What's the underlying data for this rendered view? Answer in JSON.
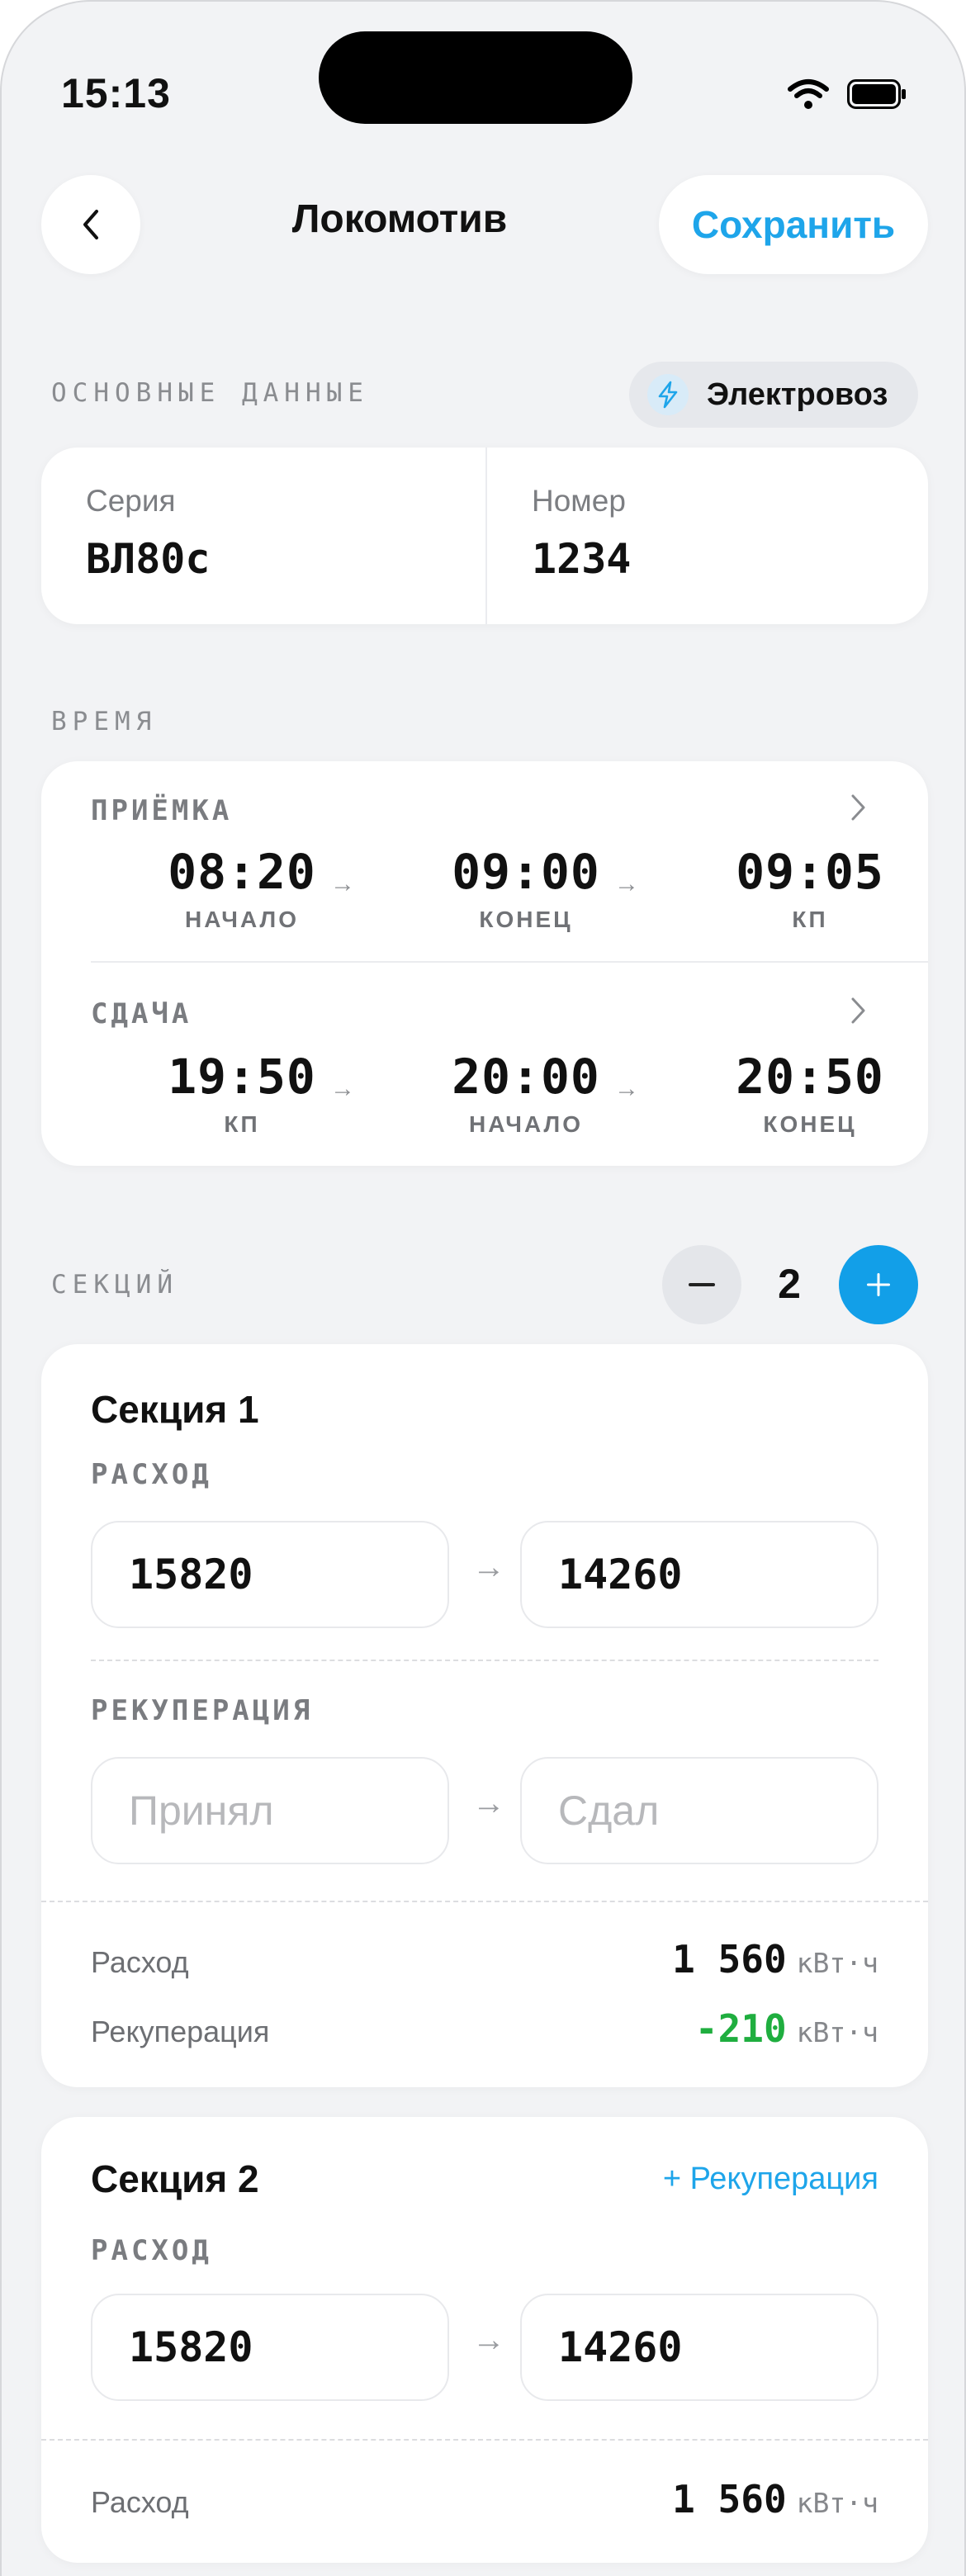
{
  "status_bar": {
    "time": "15:13"
  },
  "nav": {
    "title": "Локомотив",
    "save_label": "Сохранить"
  },
  "basic": {
    "section_label": "ОСНОВНЫЕ ДАННЫЕ",
    "type_label": "Электровоз",
    "series_label": "Серия",
    "series_value": "ВЛ80с",
    "number_label": "Номер",
    "number_value": "1234"
  },
  "time": {
    "section_label": "ВРЕМЯ",
    "acceptance": {
      "label": "ПРИЁМКА",
      "entries": [
        {
          "time": "08:20",
          "label": "НАЧАЛО"
        },
        {
          "time": "09:00",
          "label": "КОНЕЦ"
        },
        {
          "time": "09:05",
          "label": "КП"
        }
      ]
    },
    "handover": {
      "label": "СДАЧА",
      "entries": [
        {
          "time": "19:50",
          "label": "КП"
        },
        {
          "time": "20:00",
          "label": "НАЧАЛО"
        },
        {
          "time": "20:50",
          "label": "КОНЕЦ"
        }
      ]
    },
    "arrow": "→"
  },
  "sections": {
    "label": "СЕКЦИЙ",
    "count": "2",
    "items": [
      {
        "title": "Секция 1",
        "consumption_label": "РАСХОД",
        "consumption_from": "15820",
        "consumption_to": "14260",
        "recuperation_label": "РЕКУПЕРАЦИЯ",
        "recuperation_from_placeholder": "Принял",
        "recuperation_to_placeholder": "Сдал",
        "summary": [
          {
            "label": "Расход",
            "value": "1 560",
            "unit": "кВт·ч",
            "color": "#111111"
          },
          {
            "label": "Рекуперация",
            "value": "-210",
            "unit": "кВт·ч",
            "color": "#1fae3f"
          }
        ]
      },
      {
        "title": "Секция 2",
        "add_recuperation_label": "+ Рекуперация",
        "consumption_label": "РАСХОД",
        "consumption_from": "15820",
        "consumption_to": "14260",
        "summary": [
          {
            "label": "Расход",
            "value": "1 560",
            "unit": "кВт·ч",
            "color": "#111111"
          }
        ]
      }
    ]
  },
  "colors": {
    "accent": "#1ea5ea",
    "positive": "#1fae3f",
    "background": "#f2f3f5"
  }
}
